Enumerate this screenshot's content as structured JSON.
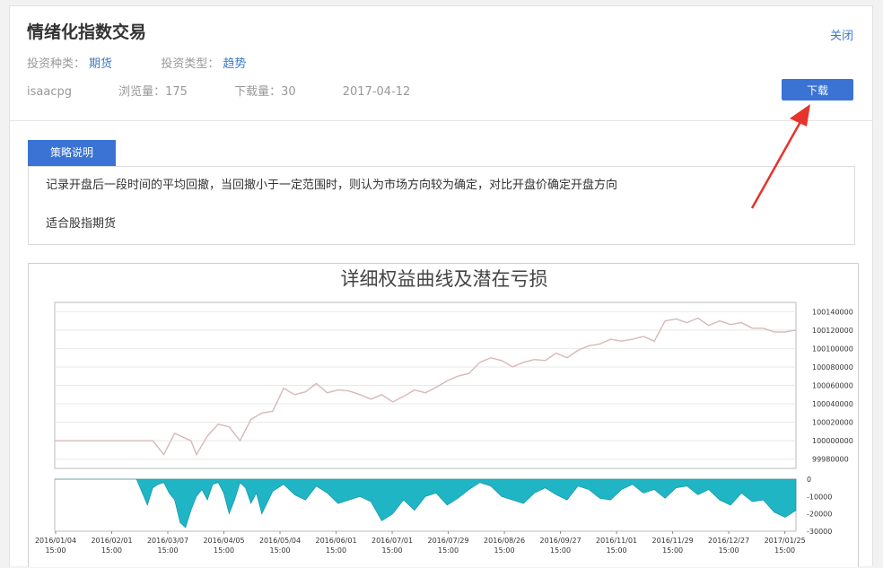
{
  "header": {
    "title": "情绪化指数交易",
    "close_label": "关闭",
    "invest_kind_label": "投资种类：",
    "invest_kind_value": "期货",
    "invest_type_label": "投资类型：",
    "invest_type_value": "趋势",
    "author": "isaacpg",
    "views": "浏览量：175",
    "downloads": "下载量：30",
    "date": "2017-04-12",
    "download_label": "下载"
  },
  "strategy": {
    "tab_label": "策略说明",
    "line1": "记录开盘后一段时间的平均回撤，当回撤小于一定范围时，则认为市场方向较为确定，对比开盘价确定开盘方向",
    "line2": "适合股指期货"
  },
  "colors": {
    "accent": "#3a73d4",
    "link": "#3a78c9",
    "equity": "#d7b8b8",
    "drawdown": "#1fb5c5",
    "arrow": "#e8322c"
  },
  "chart_data": {
    "type": "area",
    "title": "详细权益曲线及潜在亏损",
    "x_labels": [
      "2016/01/04\n15:00",
      "2016/02/01\n15:00",
      "2016/03/07\n15:00",
      "2016/04/05\n15:00",
      "2016/05/04\n15:00",
      "2016/06/01\n15:00",
      "2016/07/01\n15:00",
      "2016/07/29\n15:00",
      "2016/08/26\n15:00",
      "2016/09/27\n15:00",
      "2016/11/01\n15:00",
      "2016/11/29\n15:00",
      "2016/12/27\n15:00",
      "2017/01/25\n15:00"
    ],
    "panels": [
      {
        "name": "equity",
        "y_ticks": [
          99980000,
          100000000,
          100020000,
          100040000,
          100060000,
          100080000,
          100100000,
          100120000,
          100140000
        ],
        "ylim": [
          99970000,
          100150000
        ],
        "x": [
          0,
          0.5,
          1,
          1.5,
          1.8,
          2,
          2.2,
          2.5,
          2.6,
          2.8,
          3.0,
          3.2,
          3.4,
          3.6,
          3.8,
          4.0,
          4.2,
          4.4,
          4.6,
          4.8,
          5.0,
          5.2,
          5.4,
          5.6,
          5.8,
          6.0,
          6.2,
          6.4,
          6.6,
          6.8,
          7.0,
          7.2,
          7.4,
          7.6,
          7.8,
          8.0,
          8.2,
          8.4,
          8.6,
          8.8,
          9.0,
          9.2,
          9.4,
          9.6,
          9.8,
          10.0,
          10.2,
          10.4,
          10.6,
          10.8,
          11.0,
          11.2,
          11.4,
          11.6,
          11.8,
          12.0,
          12.2,
          12.4,
          12.6,
          12.8,
          13.0,
          13.2,
          13.4,
          13.6
        ],
        "values": [
          100000000,
          100000000,
          100000000,
          100000000,
          100000000,
          99985000,
          100008000,
          100000000,
          99985000,
          100005000,
          100018000,
          100015000,
          100000000,
          100023000,
          100030000,
          100032000,
          100057000,
          100050000,
          100053000,
          100062000,
          100052000,
          100055000,
          100054000,
          100050000,
          100045000,
          100050000,
          100042000,
          100048000,
          100055000,
          100052000,
          100058000,
          100065000,
          100070000,
          100073000,
          100085000,
          100090000,
          100087000,
          100080000,
          100085000,
          100088000,
          100087000,
          100095000,
          100090000,
          100098000,
          100103000,
          100105000,
          100110000,
          100108000,
          100110000,
          100113000,
          100108000,
          100130000,
          100132000,
          100128000,
          100133000,
          100125000,
          100130000,
          100126000,
          100128000,
          100122000,
          100122000,
          100118000,
          100118000,
          100120000
        ]
      },
      {
        "name": "drawdown",
        "y_ticks": [
          0,
          -10000,
          -20000,
          -30000
        ],
        "ylim": [
          -30000,
          0
        ],
        "x": [
          0,
          1.5,
          1.7,
          1.8,
          1.9,
          2.0,
          2.1,
          2.2,
          2.3,
          2.4,
          2.5,
          2.6,
          2.7,
          2.8,
          2.9,
          3.0,
          3.1,
          3.2,
          3.3,
          3.4,
          3.5,
          3.6,
          3.7,
          3.8,
          4.0,
          4.2,
          4.4,
          4.6,
          4.8,
          5.0,
          5.2,
          5.4,
          5.6,
          5.8,
          6.0,
          6.2,
          6.4,
          6.6,
          6.8,
          7.0,
          7.2,
          7.4,
          7.6,
          7.8,
          8.0,
          8.2,
          8.4,
          8.6,
          8.8,
          9.0,
          9.2,
          9.4,
          9.6,
          9.8,
          10.0,
          10.2,
          10.4,
          10.6,
          10.8,
          11.0,
          11.2,
          11.4,
          11.6,
          11.8,
          12.0,
          12.2,
          12.4,
          12.6,
          12.8,
          13.0,
          13.2,
          13.4,
          13.6
        ],
        "values": [
          0,
          0,
          -15000,
          -5000,
          -3000,
          -2000,
          -8000,
          -12000,
          -25000,
          -28000,
          -18000,
          -10000,
          -6000,
          -12000,
          -3000,
          -2000,
          -8000,
          -20000,
          -12000,
          -2000,
          -5000,
          -14000,
          -8000,
          -20000,
          -7000,
          -3000,
          -9000,
          -12000,
          -4000,
          -8000,
          -14000,
          -12000,
          -10000,
          -13000,
          -24000,
          -20000,
          -12000,
          -18000,
          -10000,
          -8000,
          -15000,
          -11000,
          -6000,
          -2000,
          -4000,
          -10000,
          -12000,
          -14000,
          -8000,
          -5000,
          -9000,
          -12000,
          -4000,
          -6000,
          -11000,
          -12000,
          -6000,
          -3000,
          -8000,
          -6000,
          -11000,
          -5000,
          -4000,
          -9000,
          -6000,
          -12000,
          -15000,
          -8000,
          -13000,
          -12000,
          -19000,
          -22000,
          -18000
        ]
      }
    ]
  }
}
